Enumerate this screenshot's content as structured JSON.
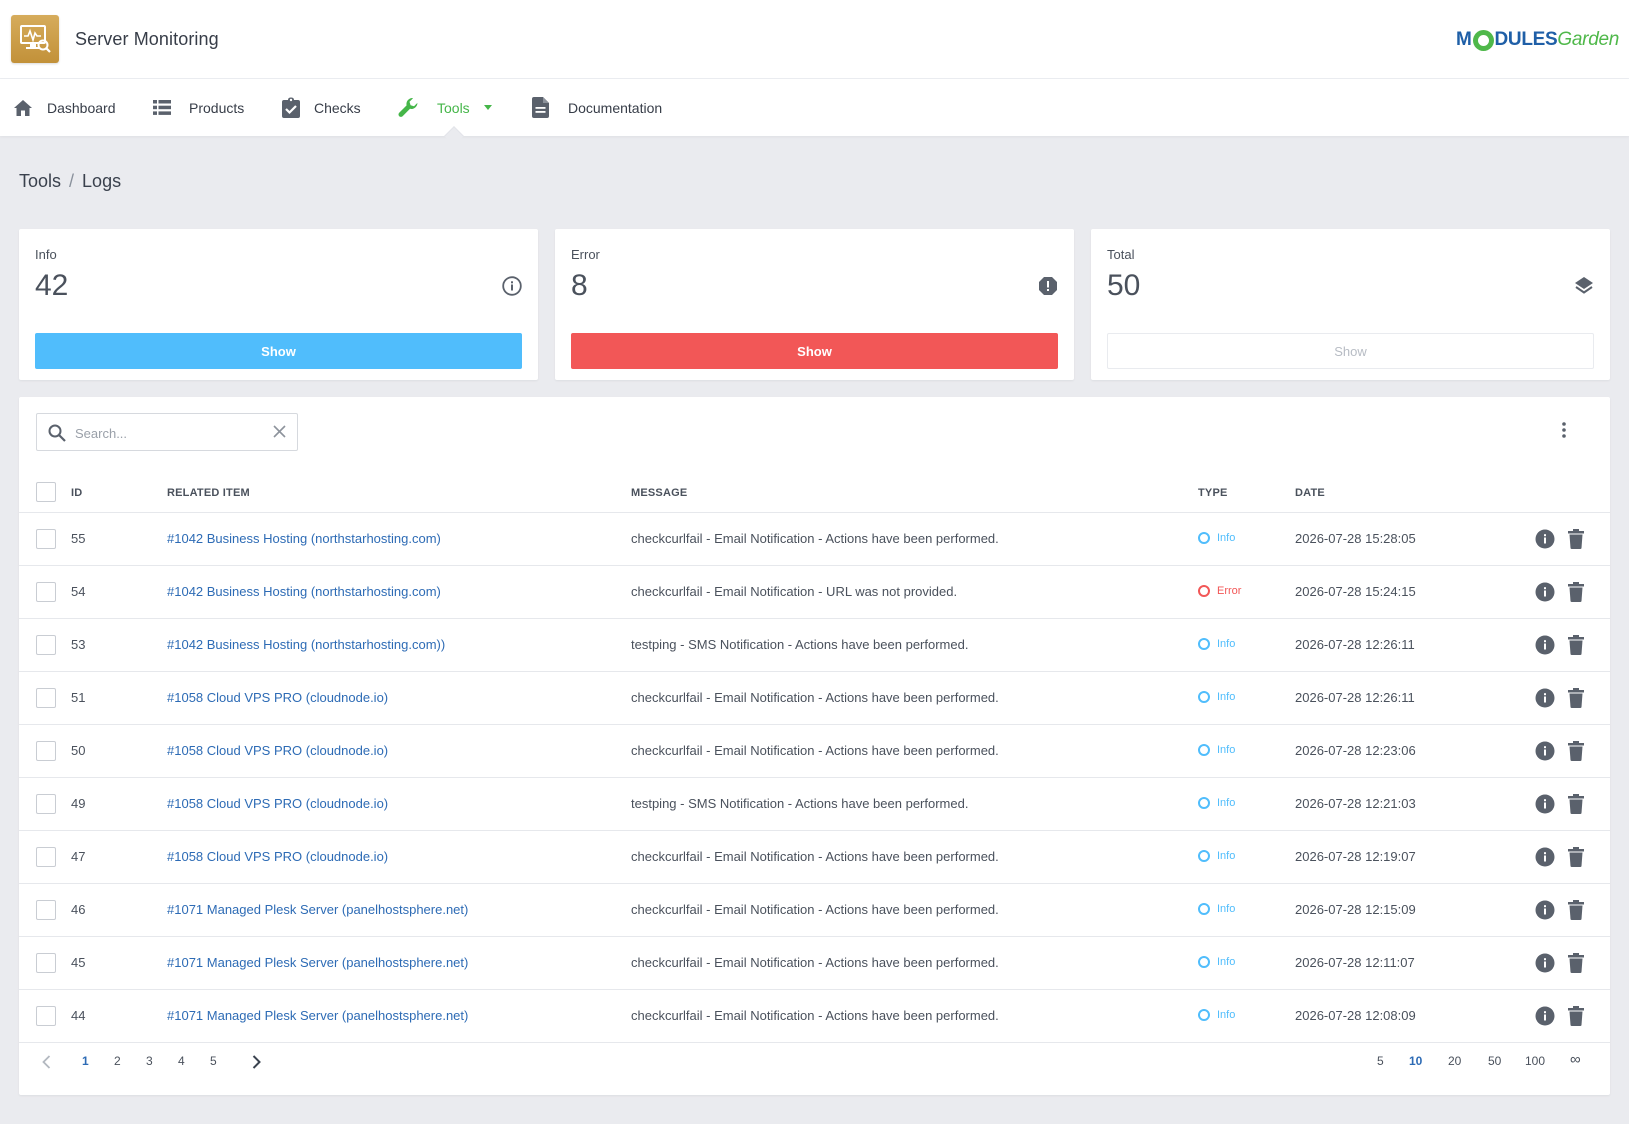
{
  "app": {
    "title": "Server Monitoring",
    "brand_part1": "M",
    "brand_part2": "DULES",
    "brand_part3": "Garden"
  },
  "nav": {
    "items": [
      {
        "label": "Dashboard",
        "icon": "home-icon"
      },
      {
        "label": "Products",
        "icon": "list-icon"
      },
      {
        "label": "Checks",
        "icon": "clipboard-check-icon"
      },
      {
        "label": "Tools",
        "icon": "wrench-icon",
        "active": true
      },
      {
        "label": "Documentation",
        "icon": "document-icon"
      }
    ]
  },
  "breadcrumb": {
    "parent": "Tools",
    "separator": "/",
    "current": "Logs"
  },
  "cards": [
    {
      "label": "Info",
      "value": "42",
      "button": "Show",
      "icon": "info-circle-icon",
      "color": "#50bdfc"
    },
    {
      "label": "Error",
      "value": "8",
      "button": "Show",
      "icon": "error-octagon-icon",
      "color": "#f25757"
    },
    {
      "label": "Total",
      "value": "50",
      "button": "Show",
      "icon": "layers-icon",
      "color": "#ffffff"
    }
  ],
  "search": {
    "placeholder": "Search..."
  },
  "table": {
    "headers": {
      "id": "ID",
      "related": "RELATED ITEM",
      "message": "MESSAGE",
      "type": "TYPE",
      "date": "DATE"
    },
    "rows": [
      {
        "id": "55",
        "related": "#1042 Business Hosting (northstarhosting.com)",
        "message": "checkcurlfail - Email Notification - Actions have been performed.",
        "type": "Info",
        "date": "2026-07-28 15:28:05"
      },
      {
        "id": "54",
        "related": "#1042 Business Hosting (northstarhosting.com)",
        "message": "checkcurlfail - Email Notification - URL was not provided.",
        "type": "Error",
        "date": "2026-07-28 15:24:15"
      },
      {
        "id": "53",
        "related": "#1042 Business Hosting (northstarhosting.com))",
        "message": "testping - SMS Notification - Actions have been performed.",
        "type": "Info",
        "date": "2026-07-28 12:26:11"
      },
      {
        "id": "51",
        "related": "#1058 Cloud VPS PRO (cloudnode.io)",
        "message": "checkcurlfail - Email Notification - Actions have been performed.",
        "type": "Info",
        "date": "2026-07-28 12:26:11"
      },
      {
        "id": "50",
        "related": "#1058 Cloud VPS PRO (cloudnode.io)",
        "message": "checkcurlfail - Email Notification - Actions have been performed.",
        "type": "Info",
        "date": "2026-07-28 12:23:06"
      },
      {
        "id": "49",
        "related": "#1058 Cloud VPS PRO (cloudnode.io)",
        "message": "testping - SMS Notification - Actions have been performed.",
        "type": "Info",
        "date": "2026-07-28 12:21:03"
      },
      {
        "id": "47",
        "related": "#1058 Cloud VPS PRO (cloudnode.io)",
        "message": "checkcurlfail - Email Notification - Actions have been performed.",
        "type": "Info",
        "date": "2026-07-28 12:19:07"
      },
      {
        "id": "46",
        "related": "#1071 Managed Plesk Server (panelhostsphere.net)",
        "message": "checkcurlfail - Email Notification - Actions have been performed.",
        "type": "Info",
        "date": "2026-07-28 12:15:09"
      },
      {
        "id": "45",
        "related": "#1071 Managed Plesk Server (panelhostsphere.net)",
        "message": "checkcurlfail - Email Notification - Actions have been performed.",
        "type": "Info",
        "date": "2026-07-28 12:11:07"
      },
      {
        "id": "44",
        "related": "#1071 Managed Plesk Server (panelhostsphere.net)",
        "message": "checkcurlfail - Email Notification - Actions have been performed.",
        "type": "Info",
        "date": "2026-07-28 12:08:09"
      }
    ]
  },
  "pagination": {
    "pages": [
      "1",
      "2",
      "3",
      "4",
      "5"
    ],
    "current_page": "1",
    "page_sizes": [
      "5",
      "10",
      "20",
      "50",
      "100",
      "∞"
    ],
    "current_size": "10"
  }
}
